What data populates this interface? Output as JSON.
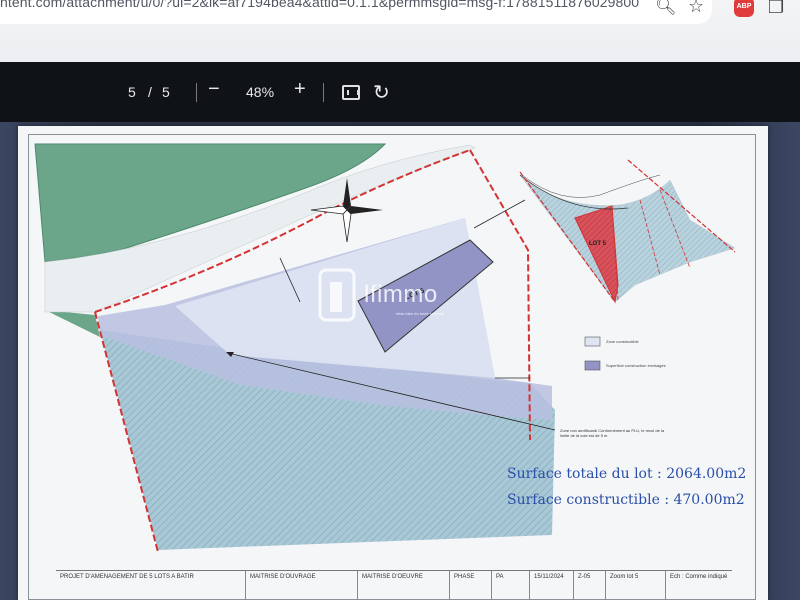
{
  "browser": {
    "url": "ntent.com/attachment/u/0/?ui=2&ik=af7194bea4&attid=0.1.1&permmsgid=msg-f:17881511876029800",
    "icons": [
      "search-icon",
      "star-icon",
      "adblock-icon",
      "extensions-icon"
    ],
    "adblock_label": "ABP"
  },
  "pdf_toolbar": {
    "current_page": "5",
    "separator": "/",
    "total_pages": "5",
    "zoom_out": "−",
    "zoom": "48%",
    "zoom_in": "+"
  },
  "plan": {
    "lot_small_label": "LOT 5",
    "lot_main_label": "LOT 5",
    "note": "Zone non aedificandi\nConformément au PLU, le recul de la limite de la voie est de 5 m",
    "legend": [
      "Zone constructible",
      "Superficie construction envisagée"
    ],
    "surface_total": "Surface totale du lot : 2064.00m2",
    "surface_constructible": "Surface constructible : 470.00m2"
  },
  "watermark": {
    "brand": "lfimmo",
    "tagline": "mise bien en toute sérénité"
  },
  "title_block": {
    "project": "PROJET D'AMENAGEMENT DE 5 LOTS A BATIR",
    "maitrise_ouvrage": "MAITRISE D'OUVRAGE",
    "maitrise_oeuvre": "MAITRISE D'OEUVRE",
    "phase_label": "PHASE",
    "phase_value": "PA",
    "date": "15/11/2024",
    "sheet": "Z-05",
    "sheet_title": "Zoom lot 5",
    "echelle": "Ech : Comme indiqué"
  },
  "colors": {
    "green_zone": "#6ba58a",
    "hatched_zone": "#9cbfcf",
    "build_zone": "#a6a8d8",
    "lot_red": "#d9515a",
    "boundary_red": "#d33333",
    "surface_text": "#2a4fa8"
  }
}
